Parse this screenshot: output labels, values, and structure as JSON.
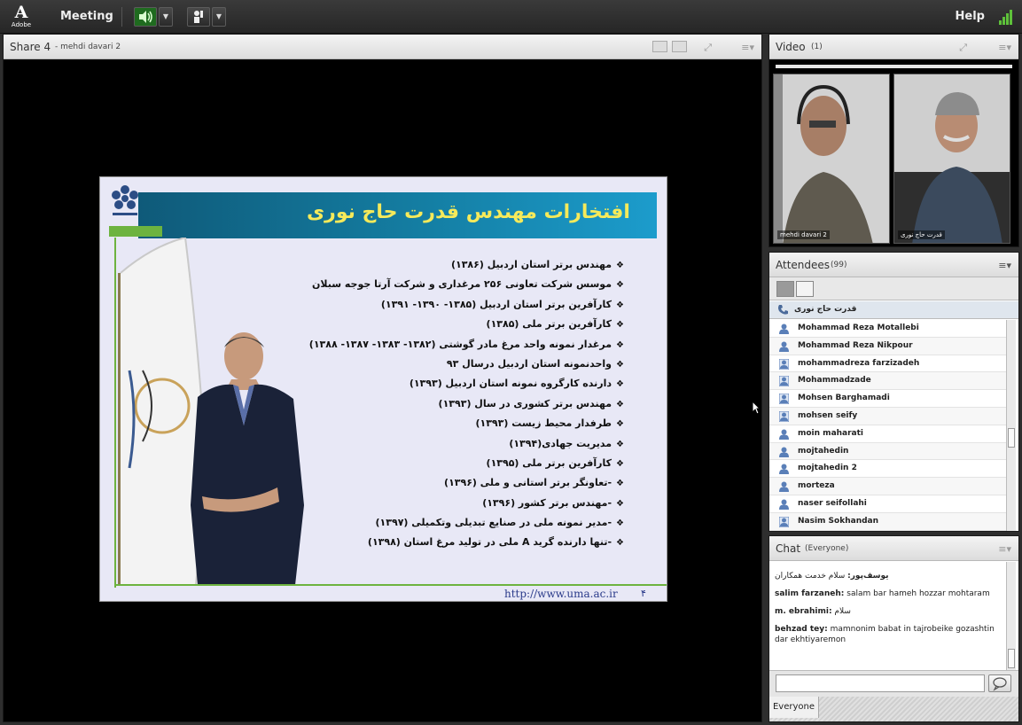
{
  "topbar": {
    "logo_text": "Adobe",
    "menu_meeting": "Meeting",
    "help": "Help"
  },
  "share": {
    "title": "Share 4",
    "subtitle": "- mehdi davari 2",
    "slide": {
      "title": "افتخارات مهندس قدرت حاج نوری",
      "bullets": [
        "مهندس برتر استان اردبیل (۱۳۸۶)",
        "موسس شرکت تعاونی ۲۵۶ مرغداری و شرکت آرتا جوجه سبلان",
        "کارآفرین برتر استان اردبیل (۱۳۸۵- ۱۳۹۰- ۱۳۹۱)",
        "کارآفرین برتر ملی (۱۳۸۵)",
        "مرغدار نمونه واحد مرغ مادر گوشتی (۱۳۸۲- ۱۳۸۳- ۱۳۸۷- ۱۳۸۸)",
        "واحدنمونه  استان اردبیل درسال ۹۳",
        "دارنده کارگروه نمونه استان اردبیل (۱۳۹۳)",
        "مهندس برتر کشوری در سال (۱۳۹۳)",
        "طرفدار محیط زیست (۱۳۹۳)",
        "مدیریت جهادی(۱۳۹۴)",
        "کارآفرین برتر ملی (۱۳۹۵)",
        "-تعاونگر برتر استانی و ملی (۱۳۹۶)",
        "-مهندس برتر کشور (۱۳۹۶)",
        "-مدیر نمونه ملی در صنایع تبدیلی وتکمیلی (۱۳۹۷)",
        "-تنها دارنده گرید A ملی در تولید مرغ استان (۱۳۹۸)"
      ],
      "url": "http://www.uma.ac.ir",
      "page_number": "۴"
    }
  },
  "video": {
    "title": "Video",
    "count": "(1)",
    "feeds": [
      {
        "label": "mehdi davari 2"
      },
      {
        "label": "قدرت حاج نوری"
      }
    ]
  },
  "attendees": {
    "title": "Attendees",
    "count": "(99)",
    "host": "قدرت حاج نوری",
    "list": [
      "Mohammad Reza Motallebi",
      "Mohammad Reza Nikpour",
      "mohammadreza farzizadeh",
      "Mohammadzade",
      "Mohsen Barghamadi",
      "mohsen seify",
      "moin maharati",
      "mojtahedin",
      "mojtahedin 2",
      "morteza",
      "naser seifollahi",
      "Nasim Sokhandan"
    ]
  },
  "chat": {
    "title": "Chat",
    "scope": "(Everyone)",
    "messages": [
      {
        "sender": "یوسف‌پور:",
        "text": "سلام خدمت همکاران"
      },
      {
        "sender": "salim farzaneh:",
        "text": "salam bar hameh hozzar mohtaram"
      },
      {
        "sender": "m. ebrahimi:",
        "text": "سلام"
      },
      {
        "sender": "behzad tey:",
        "text": "mamnonim babat in tajrobeike gozashtin dar ekhtiyaremon"
      }
    ],
    "input_placeholder": "",
    "footer_tab": "Everyone"
  },
  "colors": {
    "banner": "#147ea3",
    "banner_title": "#f6ea5a",
    "accent_green": "#6db33f",
    "signal": "#5ec13a"
  }
}
